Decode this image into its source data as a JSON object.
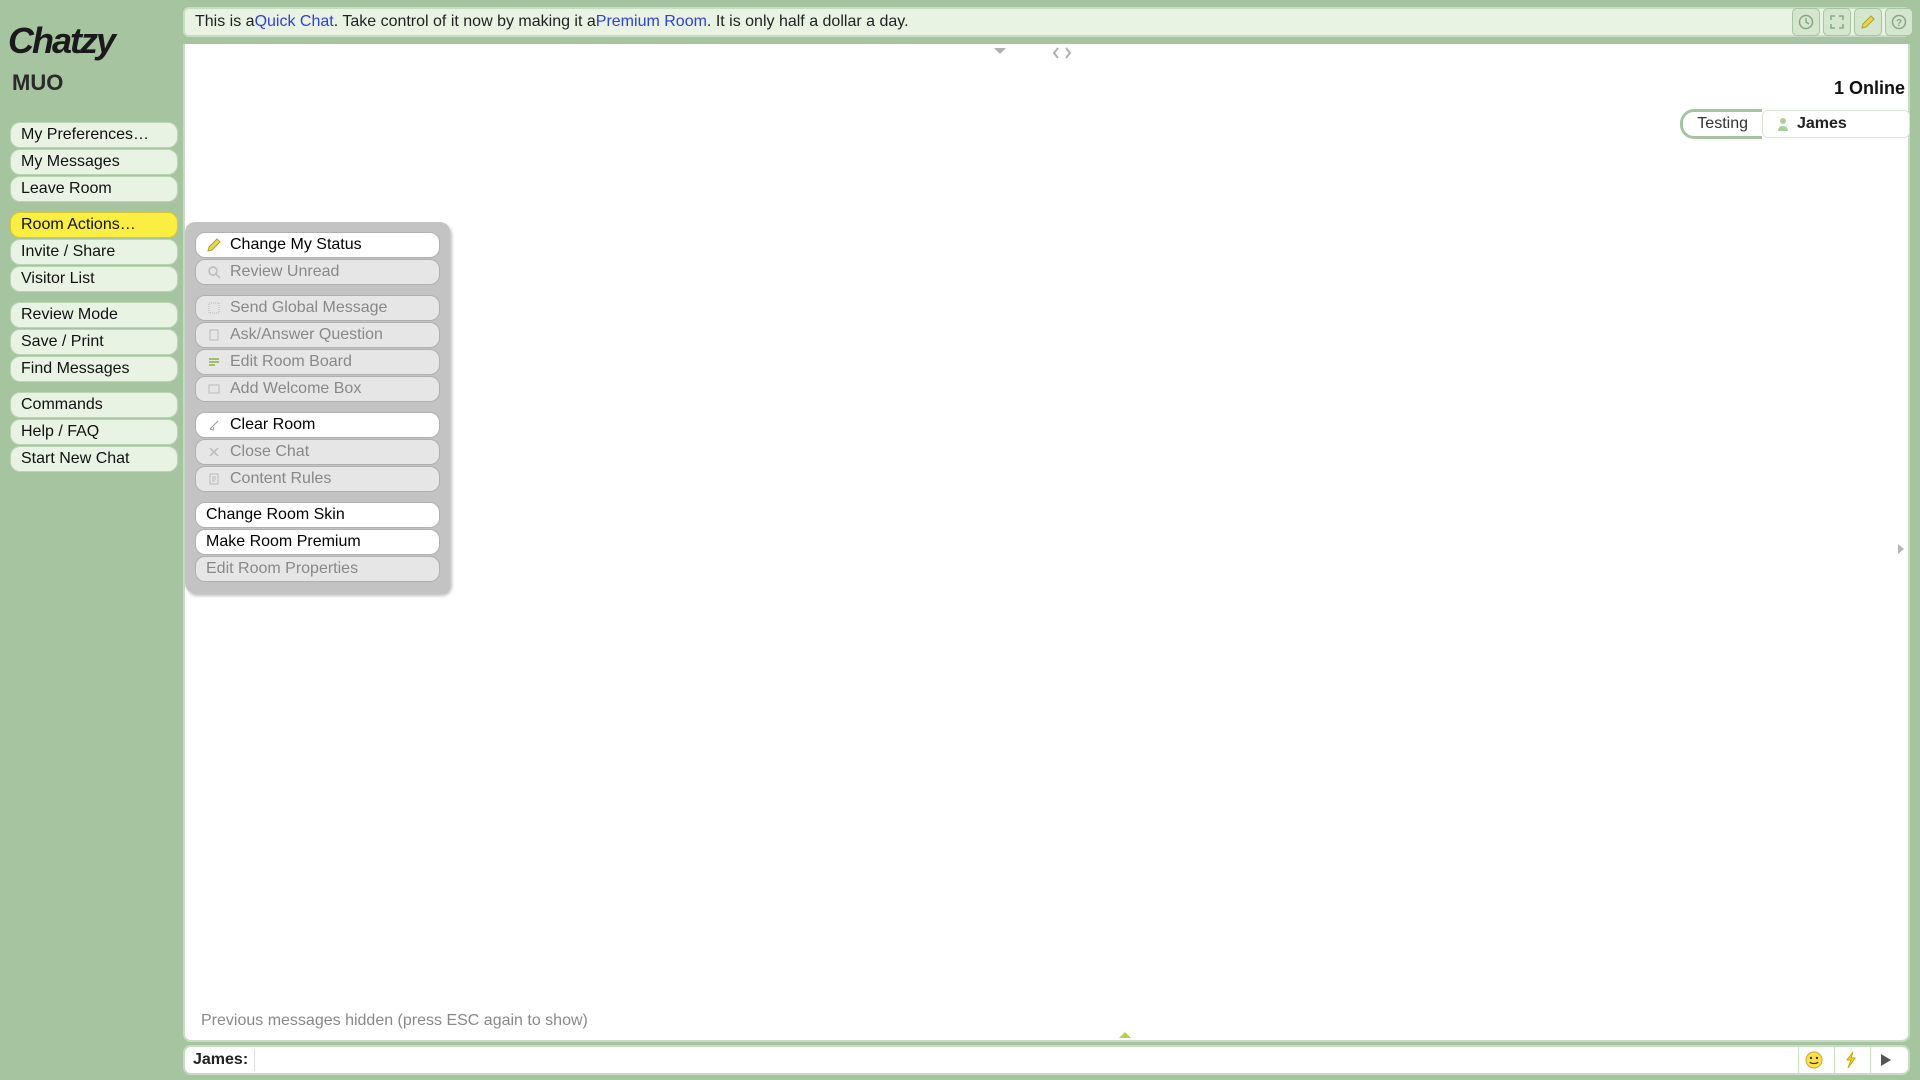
{
  "logo": "Chatzy",
  "room_name": "MUO",
  "banner": {
    "prefix": "This is a ",
    "link1": "Quick Chat",
    "middle": ". Take control of it now by making it a ",
    "link2": "Premium Room",
    "suffix": ". It is only half a dollar a day."
  },
  "sidebar": {
    "groups": [
      [
        "My Preferences…",
        "My Messages",
        "Leave Room"
      ],
      [
        "Room Actions…",
        "Invite / Share",
        "Visitor List"
      ],
      [
        "Review Mode",
        "Save / Print",
        "Find Messages"
      ],
      [
        "Commands",
        "Help / FAQ",
        "Start New Chat"
      ]
    ],
    "active": "Room Actions…"
  },
  "popup": {
    "groups": [
      [
        {
          "label": "Change My Status",
          "icon": "pencil",
          "enabled": true
        },
        {
          "label": "Review Unread",
          "icon": "search",
          "enabled": false
        }
      ],
      [
        {
          "label": "Send Global Message",
          "icon": "globe-msg",
          "enabled": false
        },
        {
          "label": "Ask/Answer Question",
          "icon": "question",
          "enabled": false
        },
        {
          "label": "Edit Room Board",
          "icon": "board",
          "enabled": false
        },
        {
          "label": "Add Welcome Box",
          "icon": "box",
          "enabled": false
        }
      ],
      [
        {
          "label": "Clear Room",
          "icon": "broom",
          "enabled": true
        },
        {
          "label": "Close Chat",
          "icon": "close",
          "enabled": false
        },
        {
          "label": "Content Rules",
          "icon": "rules",
          "enabled": false
        }
      ],
      [
        {
          "label": "Change Room Skin",
          "icon": "",
          "enabled": true
        },
        {
          "label": "Make Room Premium",
          "icon": "",
          "enabled": true
        },
        {
          "label": "Edit Room Properties",
          "icon": "",
          "enabled": false
        }
      ]
    ]
  },
  "hidden_msg": "Previous messages hidden (press ESC again to show)",
  "online": {
    "count_label": "1 Online",
    "status": "Testing",
    "name": "James"
  },
  "input": {
    "label": "James",
    "placeholder": ""
  }
}
